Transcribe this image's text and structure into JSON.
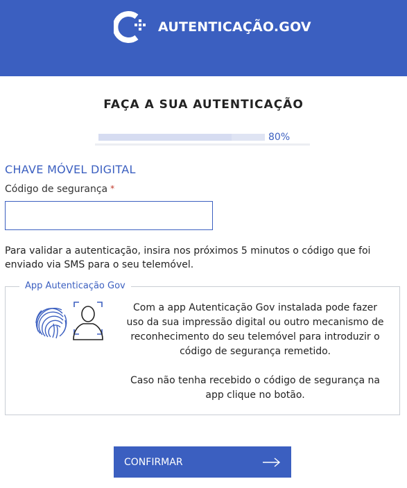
{
  "header": {
    "brand_text": "AUTENTICAÇÃO.GOV",
    "bg_color": "#3b5fc0"
  },
  "page_title": "FAÇA A SUA AUTENTICAÇÃO",
  "progress": {
    "value": 0.8,
    "label": "80%"
  },
  "form": {
    "section_title": "CHAVE MÓVEL DIGITAL",
    "field_label": "Código de segurança",
    "required_mark": "*",
    "input_value": "",
    "instructions": "Para validar a autenticação, insira nos próximos 5 minutos o código que foi enviado via SMS para o seu telemóvel."
  },
  "app_box": {
    "legend": "App Autenticação Gov",
    "paragraph_1": "Com a app Autenticação Gov instalada pode fazer uso da sua impressão digital ou outro mecanismo de reconhecimento do seu telemóvel para introduzir o código de segurança remetido.",
    "paragraph_2": "Caso não tenha recebido o código de segurança na app clique no botão.",
    "icons": [
      "fingerprint-icon",
      "face-scan-icon"
    ]
  },
  "confirm_button": {
    "label": "CONFIRMAR",
    "icon": "arrow-right-icon"
  }
}
